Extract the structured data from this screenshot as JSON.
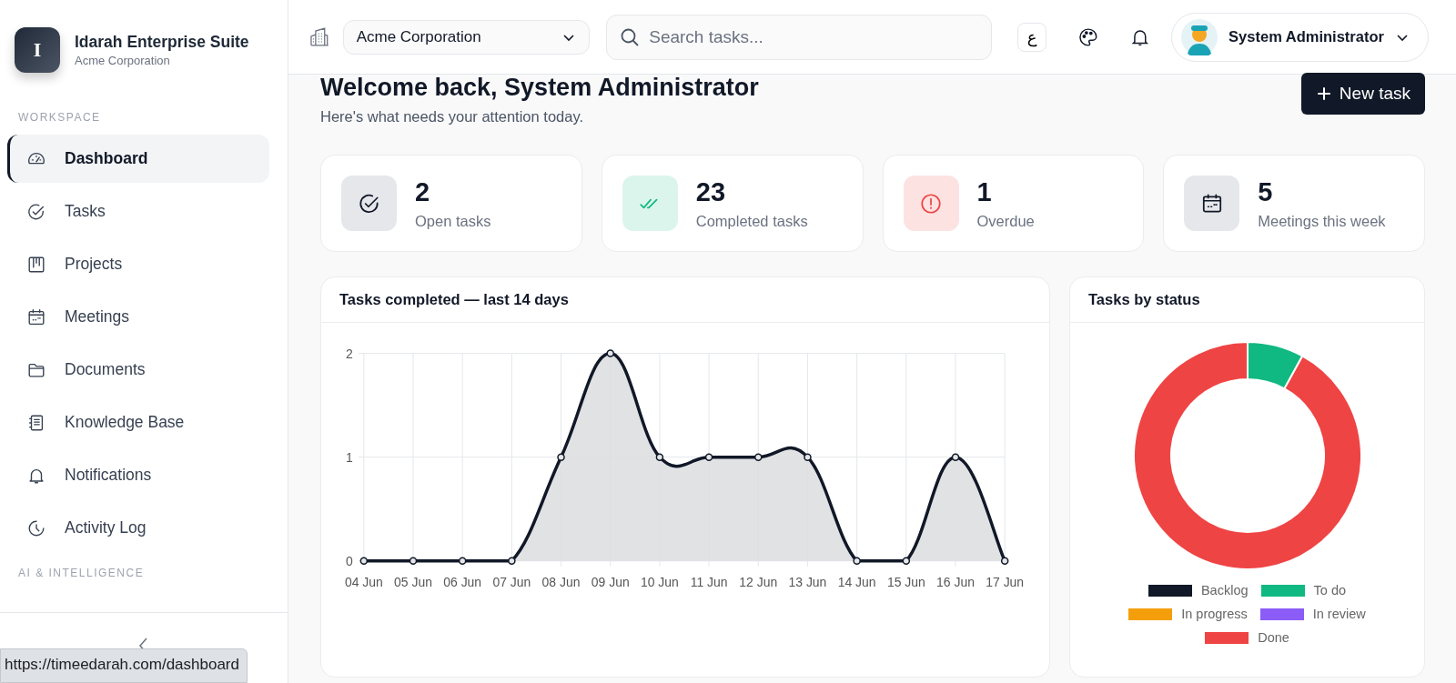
{
  "sidebar": {
    "brand": {
      "logo_letter": "I",
      "title": "Idarah Enterprise Suite",
      "subtitle": "Acme Corporation"
    },
    "workspace_label": "WORKSPACE",
    "items": [
      {
        "label": "Dashboard",
        "selected": true
      },
      {
        "label": "Tasks",
        "selected": false
      },
      {
        "label": "Projects",
        "selected": false
      },
      {
        "label": "Meetings",
        "selected": false
      },
      {
        "label": "Documents",
        "selected": false
      },
      {
        "label": "Knowledge Base",
        "selected": false
      },
      {
        "label": "Notifications",
        "selected": false
      },
      {
        "label": "Activity Log",
        "selected": false
      }
    ],
    "ai_label": "AI & INTELLIGENCE"
  },
  "status_url": "https://timeedarah.com/dashboard",
  "header": {
    "company": "Acme Corporation",
    "search": {
      "placeholder": "Search tasks..."
    },
    "language": "ع",
    "user": "System Administrator"
  },
  "welcome": {
    "title": "Welcome back, System Administrator",
    "subtitle": "Here's what needs your attention today.",
    "new_task": "New task"
  },
  "stats": [
    {
      "kind": "open",
      "value": "2",
      "label": "Open tasks"
    },
    {
      "kind": "completed",
      "value": "23",
      "label": "Completed tasks"
    },
    {
      "kind": "overdue",
      "value": "1",
      "label": "Overdue"
    },
    {
      "kind": "meetings",
      "value": "5",
      "label": "Meetings this week"
    }
  ],
  "charts": {
    "completed": {
      "chart_data": {
        "type": "area",
        "title": "Tasks completed — last 14 days",
        "categories": [
          "04 Jun",
          "05 Jun",
          "06 Jun",
          "07 Jun",
          "08 Jun",
          "09 Jun",
          "10 Jun",
          "11 Jun",
          "12 Jun",
          "13 Jun",
          "14 Jun",
          "15 Jun",
          "16 Jun",
          "17 Jun"
        ],
        "ylim": [
          0,
          2
        ],
        "yticks": [
          0,
          1,
          2
        ],
        "grid": true,
        "series": [
          {
            "color": "#111827",
            "values": [
              0,
              0,
              0,
              0,
              1,
              2,
              1,
              1,
              1,
              1,
              0,
              0,
              1,
              0
            ]
          }
        ]
      }
    },
    "status": {
      "chart_data": {
        "type": "donut",
        "title": "Tasks by status",
        "categories": [
          "Backlog",
          "To do",
          "In progress",
          "In review",
          "Done"
        ],
        "values": [
          0,
          8,
          0,
          0,
          92
        ],
        "legend": true,
        "colors": [
          "#111827",
          "#10b981",
          "#f59e0b",
          "#8b5cf6",
          "#ef4444"
        ]
      }
    }
  }
}
